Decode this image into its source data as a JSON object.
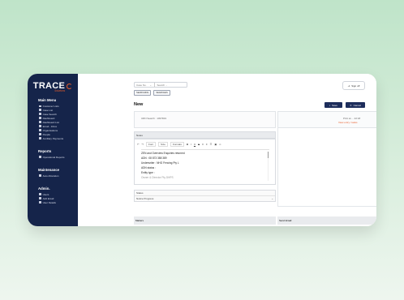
{
  "brand": {
    "name": "TRACE",
    "tagline": "Solutions",
    "accent": "#e85d2a",
    "sidebar_bg": "#15244a"
  },
  "sidebar": {
    "main_menu_title": "Main Menu",
    "main_items": [
      {
        "label": "Customer Lists",
        "icon": "list-icon"
      },
      {
        "label": "Case List",
        "icon": "list-icon"
      },
      {
        "label": "Case Search",
        "icon": "search-icon"
      },
      {
        "label": "Dashboard",
        "icon": "dashboard-icon"
      },
      {
        "label": "Dashboard List",
        "icon": "list-icon"
      },
      {
        "label": "Email - Inbox",
        "icon": "mail-icon"
      },
      {
        "label": "Organisations",
        "icon": "building-icon"
      },
      {
        "label": "People",
        "icon": "person-icon"
      },
      {
        "label": "Ancillary Payments",
        "icon": "payment-icon"
      }
    ],
    "reports_title": "Reports",
    "reports_items": [
      {
        "label": "Operational Reports",
        "icon": "report-icon"
      }
    ],
    "maintenance_title": "Maintenance",
    "maintenance_items": [
      {
        "label": "Auto Allocation",
        "icon": "gear-icon"
      }
    ],
    "admin_title": "Admin.",
    "admin_items": [
      {
        "label": "Users",
        "icon": "user-icon"
      },
      {
        "label": "Add Email",
        "icon": "mail-icon"
      },
      {
        "label": "User Details",
        "icon": "user-icon"
      }
    ]
  },
  "topbar": {
    "search_select": "Case No.",
    "search_placeholder": "Search ...",
    "signoff_label": "Sign off"
  },
  "tabs": [
    "SEARCHING",
    "SEARCHES"
  ],
  "page_title": "New",
  "buttons": {
    "save": "Save",
    "cancel": "Cancel"
  },
  "left_panel": {
    "row_text": "URN Search : 1097819"
  },
  "notes_header": "Notes",
  "editor": {
    "toolbar": [
      "Undo",
      "Redo",
      "Font",
      "Size",
      "Formats",
      "B",
      "I",
      "U",
      "S"
    ],
    "font_select": "Font",
    "size_select": "Size",
    "format_select": "Formats",
    "lines": [
      "ZEN and Overview Enquiries returned",
      "ADN : 08 873 388 389",
      "Underwriter : NHG Fencing Pty L",
      "ADN status :",
      "Entity type :",
      "Owner & Director Pty DHPS"
    ]
  },
  "status_block": {
    "label": "Status",
    "value": "Notice Progress"
  },
  "right_panel": {
    "line1": "Print at ... 22:18",
    "line2": "View entry / tasks"
  },
  "bottom_left": "Matters",
  "bottom_right": "Send Email"
}
